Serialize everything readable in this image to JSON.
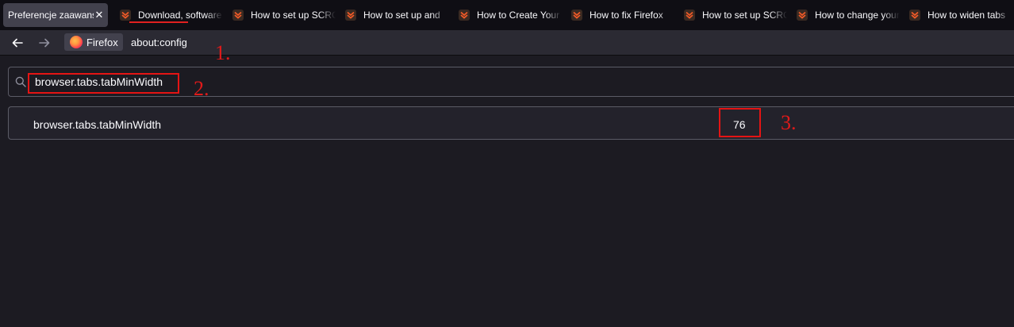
{
  "tabs": {
    "active": {
      "label": "Preferencje zaawansowane",
      "close": "✕"
    },
    "items": [
      {
        "label": "Download, software"
      },
      {
        "label": "How to set up SCRCPY"
      },
      {
        "label": "How to set up and"
      },
      {
        "label": "How to Create Your"
      },
      {
        "label": "How to fix Firefox"
      },
      {
        "label": "How to set up SCRCPY"
      },
      {
        "label": "How to change your"
      },
      {
        "label": "How to widen tabs"
      }
    ]
  },
  "nav": {
    "back_icon": "back-arrow-icon",
    "forward_icon": "forward-arrow-icon",
    "identity_label": "Firefox",
    "url": "about:config"
  },
  "search": {
    "value": "browser.tabs.tabMinWidth"
  },
  "preference": {
    "name": "browser.tabs.tabMinWidth",
    "value": "76"
  },
  "annotations": {
    "step1": "1.",
    "step2": "2.",
    "step3": "3."
  },
  "colors": {
    "background": "#1c1b22",
    "annotation": "#e41414",
    "tabstrip": "#0f0e14",
    "favicon": "#f05a28"
  }
}
